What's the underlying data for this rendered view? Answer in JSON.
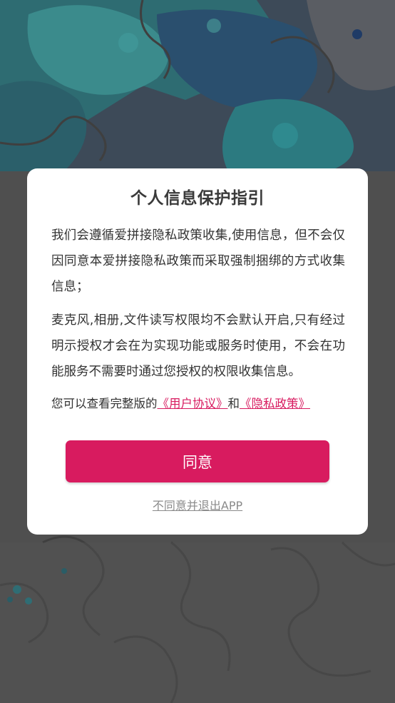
{
  "dialog": {
    "title": "个人信息保护指引",
    "paragraph_1": "我们会遵循爱拼接隐私政策收集,使用信息，但不会仅因同意本爱拼接隐私政策而采取强制捆绑的方式收集信息；",
    "paragraph_2": "麦克风,相册,文件读写权限均不会默认开启,只有经过明示授权才会在为实现功能或服务时使用，不会在功能服务不需要时通过您授权的权限收集信息。",
    "links_prefix": "您可以查看完整版的",
    "user_agreement_link": "《用户协议》",
    "links_joiner": "和",
    "privacy_policy_link": "《隐私政策》",
    "agree_button": "同意",
    "disagree_link": "不同意并退出APP"
  },
  "colors": {
    "accent": "#d81b5f",
    "overlay": "#525252",
    "dialog_bg": "#ffffff"
  },
  "background": {
    "illustration": "puzzle-pieces-artwork"
  }
}
